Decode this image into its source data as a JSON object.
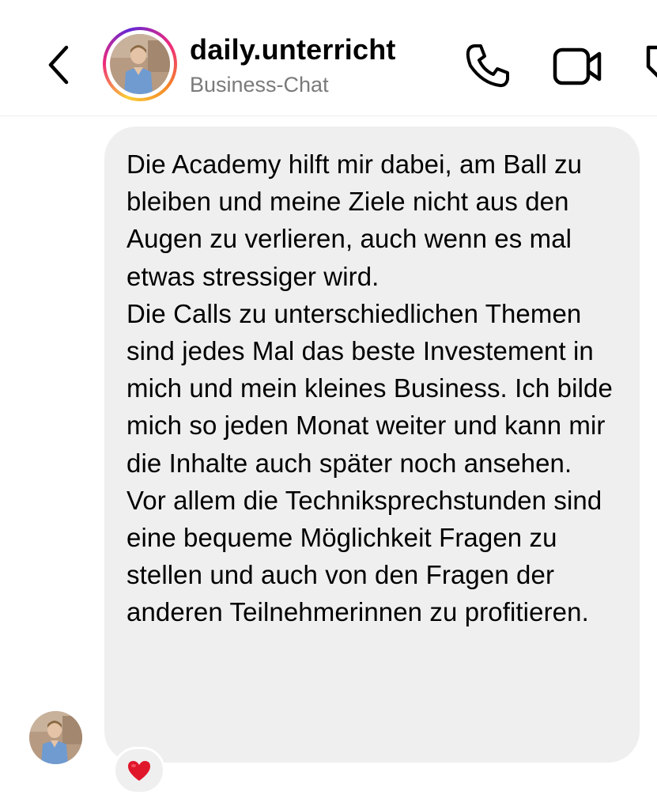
{
  "header": {
    "back_icon": "chevron-left-icon",
    "username": "daily.unterricht",
    "subtitle": "Business-Chat",
    "avatar_icon": "profile-photo",
    "actions": [
      "phone-icon",
      "video-camera-icon",
      "tag-icon"
    ]
  },
  "message": {
    "paragraphs": [
      "Die Academy hilft mir dabei, am Ball zu bleiben und meine Ziele nicht aus den Augen zu verlieren, auch wenn es mal etwas stressiger wird.",
      "Die Calls zu unterschiedlichen Themen sind jedes Mal das beste Investement in mich und mein kleines Business. Ich bilde mich so jeden Monat weiter und kann mir die Inhalte auch später noch ansehen.",
      "Vor allem die Technik­sprechstunden sind eine bequeme Möglichkeit Fragen zu stellen und auch von den Fragen der anderen Teilnehmerinnen zu profitieren."
    ],
    "reaction": "❤️"
  },
  "colors": {
    "bubble": "#efefef",
    "subtitle": "#7a7a7a",
    "heart": "#e0162b"
  }
}
